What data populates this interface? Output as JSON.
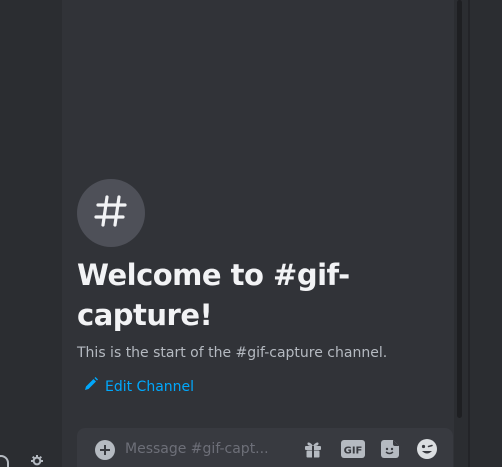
{
  "channel": {
    "welcome_title": "Welcome to #gif-capture!",
    "start_text": "This is the start of the #gif-capture channel.",
    "edit_label": "Edit Channel"
  },
  "composer": {
    "placeholder": "Message #gif-capt...",
    "gif_label": "GIF"
  },
  "icons": {
    "channel_badge": "hashtag-icon",
    "edit": "pencil-icon",
    "add": "plus-circle-icon",
    "gift": "gift-icon",
    "gif": "gif-icon",
    "sticker": "sticker-icon",
    "emoji": "emoji-icon",
    "headphones": "headphones-icon",
    "settings": "gear-icon"
  },
  "colors": {
    "background": "#313338",
    "sidebar": "#2b2d31",
    "accent_link": "#00a8fc",
    "title": "#f2f3f5",
    "muted": "#b5bac1"
  }
}
